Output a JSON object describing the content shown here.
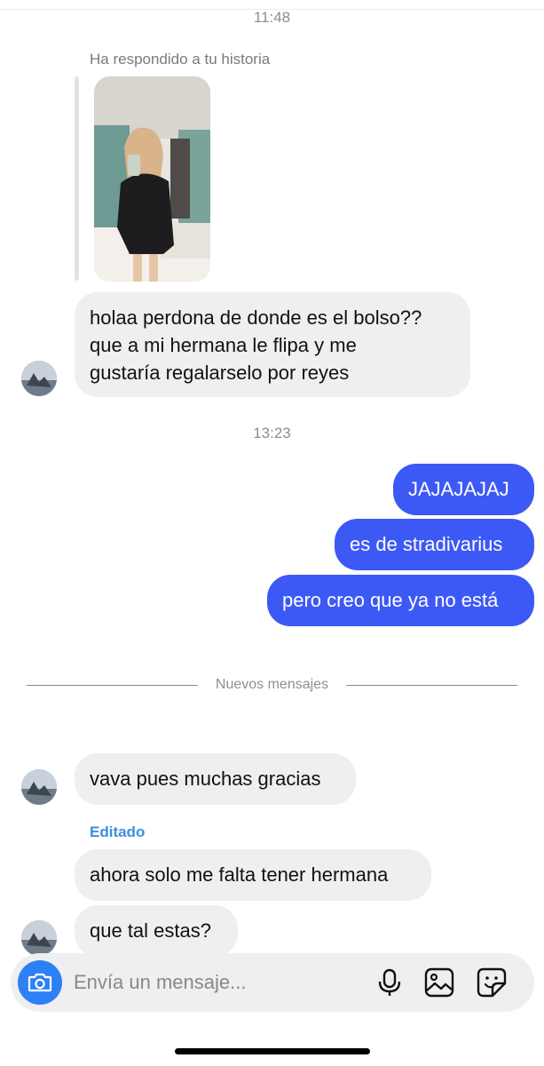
{
  "thread": {
    "time_1": "11:48",
    "story_reply_label": "Ha respondido a tu historia",
    "story_image": "story-photo",
    "msg_1_lines": [
      "holaa perdona de donde es el bolso??",
      "que a mi hermana le flipa y me",
      "gustaría regalarselo por reyes"
    ],
    "time_2": "13:23",
    "sent": [
      "JAJAJAJAJ",
      "es de stradivarius",
      "pero creo que ya no está"
    ],
    "new_messages_label": "Nuevos mensajes",
    "msg_2": "vava pues muchas gracias",
    "edited_label": "Editado",
    "msg_3": "ahora solo me falta tener hermana",
    "msg_4": "que tal estas?"
  },
  "composer": {
    "placeholder": "Envía un mensaje...",
    "icons": [
      "camera-icon",
      "microphone-icon",
      "gallery-icon",
      "sticker-icon"
    ]
  },
  "colors": {
    "sent_bubble": "#3d59f5",
    "received_bubble": "#efeff1",
    "camera_button": "#2e80f5",
    "edited_label": "#3b8fe0"
  }
}
